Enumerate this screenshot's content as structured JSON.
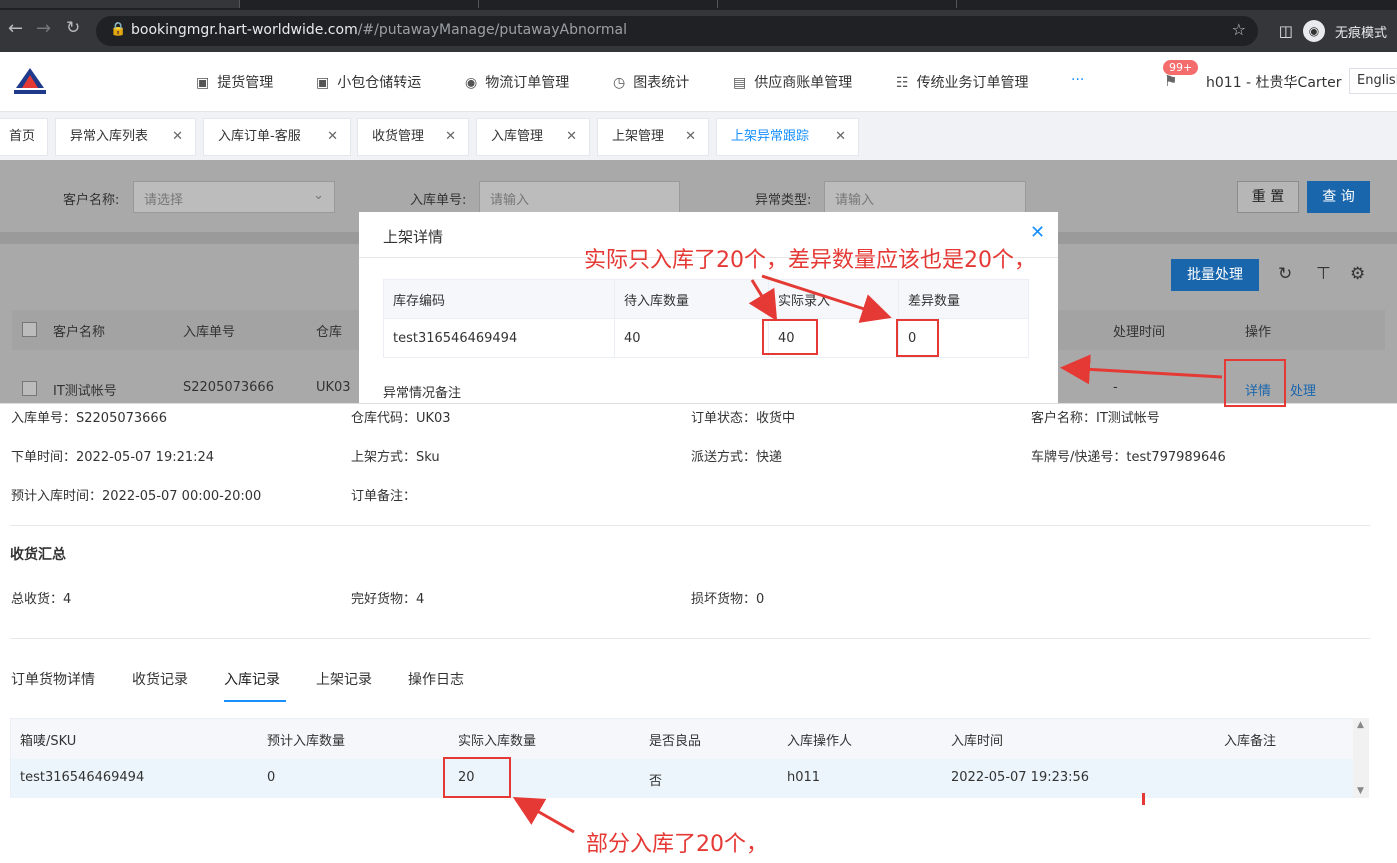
{
  "browser": {
    "url_host": "bookingmgr.hart-worldwide.com",
    "url_path": "/#/putawayManage/putawayAbnormal",
    "incognito_label": "无痕模式"
  },
  "header": {
    "menu": [
      {
        "icon": "truck-icon",
        "label": "提货管理"
      },
      {
        "icon": "package-icon",
        "label": "小包仓储转运"
      },
      {
        "icon": "globe-icon",
        "label": "物流订单管理"
      },
      {
        "icon": "chart-icon",
        "label": "图表统计"
      },
      {
        "icon": "ledger-icon",
        "label": "供应商账单管理"
      },
      {
        "icon": "hierarchy-icon",
        "label": "传统业务订单管理"
      }
    ],
    "more": "···",
    "badge": "99+",
    "user": "h011 - 杜贵华Carter",
    "language": "English"
  },
  "tabs": [
    {
      "label": "首页",
      "closable": false
    },
    {
      "label": "异常入库列表",
      "closable": true
    },
    {
      "label": "入库订单-客服",
      "closable": true
    },
    {
      "label": "收货管理",
      "closable": true
    },
    {
      "label": "入库管理",
      "closable": true
    },
    {
      "label": "上架管理",
      "closable": true
    },
    {
      "label": "上架异常跟踪",
      "closable": true,
      "active": true
    }
  ],
  "filters": {
    "customer_label": "客户名称:",
    "customer_placeholder": "请选择",
    "order_label": "入库单号:",
    "order_placeholder": "请输入",
    "type_label": "异常类型:",
    "type_placeholder": "请输入",
    "reset": "重 置",
    "query": "查 询"
  },
  "list": {
    "batch": "批量处理",
    "headers": {
      "customer": "客户名称",
      "order": "入库单号",
      "warehouse": "仓库",
      "time": "处理时间",
      "op": "操作"
    },
    "row": {
      "customer": "IT测试帐号",
      "order": "S2205073666",
      "warehouse": "UK03",
      "time": "-",
      "detail": "详情",
      "process": "处理"
    }
  },
  "modal": {
    "title": "上架详情",
    "headers": [
      "库存编码",
      "待入库数量",
      "实际录入",
      "差异数量"
    ],
    "row": [
      "test316546469494",
      "40",
      "40",
      "0"
    ],
    "note_label": "异常情况备注"
  },
  "detail": {
    "order_no": "入库单号：S2205073666",
    "warehouse_code": "仓库代码：UK03",
    "order_status": "订单状态：收货中",
    "customer": "客户名称：IT测试帐号",
    "order_time": "下单时间：2022-05-07 19:21:24",
    "putaway_method": "上架方式：Sku",
    "delivery": "派送方式：快递",
    "tracking": "车牌号/快递号：test797989646",
    "eta": "预计入库时间：2022-05-07 00:00-20:00",
    "order_note": "订单备注：",
    "summary_title": "收货汇总",
    "total": "总收货：4",
    "good": "完好货物：4",
    "damaged": "损坏货物：0",
    "tabs": [
      "订单货物详情",
      "收货记录",
      "入库记录",
      "上架记录",
      "操作日志"
    ],
    "table_headers": [
      "箱唛/SKU",
      "预计入库数量",
      "实际入库数量",
      "是否良品",
      "入库操作人",
      "入库时间",
      "入库备注"
    ],
    "table_row": [
      "test316546469494",
      "0",
      "20",
      "否",
      "h011",
      "2022-05-07 19:23:56",
      ""
    ]
  },
  "annotations": {
    "top": "实际只入库了20个，差异数量应该也是20个，",
    "bottom": "部分入库了20个，"
  }
}
